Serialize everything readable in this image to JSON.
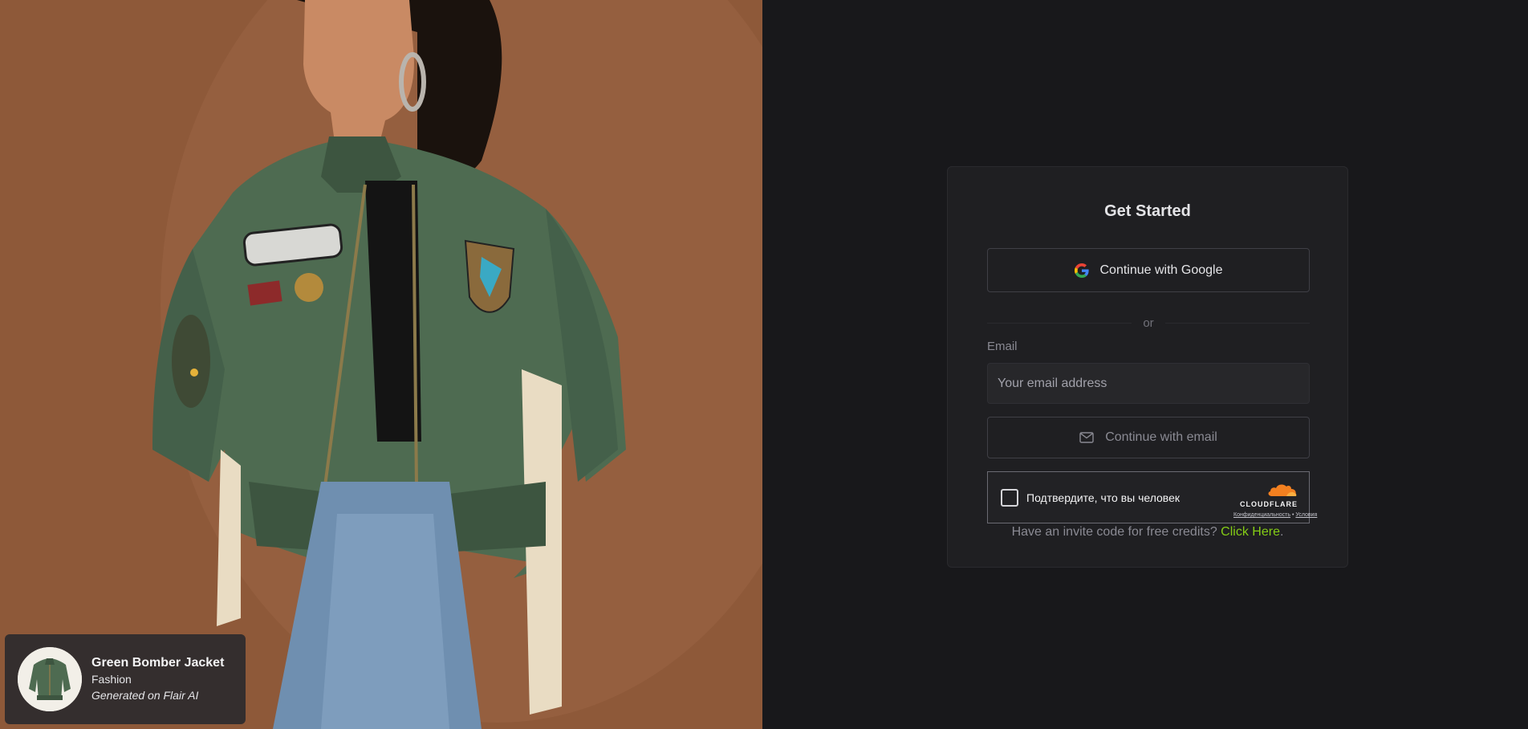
{
  "hero": {
    "caption": {
      "title": "Green Bomber Jacket",
      "category": "Fashion",
      "generated": "Generated on Flair AI"
    }
  },
  "auth": {
    "title": "Get Started",
    "google_button": "Continue with Google",
    "divider": "or",
    "email_label": "Email",
    "email_placeholder": "Your email address",
    "email_button": "Continue with email",
    "captcha": {
      "label": "Подтвердите, что вы человек",
      "brand": "CLOUDFLARE",
      "privacy": "Конфиденциальность",
      "separator": "•",
      "terms": "Условия"
    },
    "invite_text": "Have an invite code for free credits?",
    "invite_link": "Click Here",
    "invite_period": "."
  },
  "colors": {
    "background": "#18181b",
    "card": "#1f1f22",
    "accent_link": "#84cc16",
    "cloudflare_orange": "#f38020"
  }
}
